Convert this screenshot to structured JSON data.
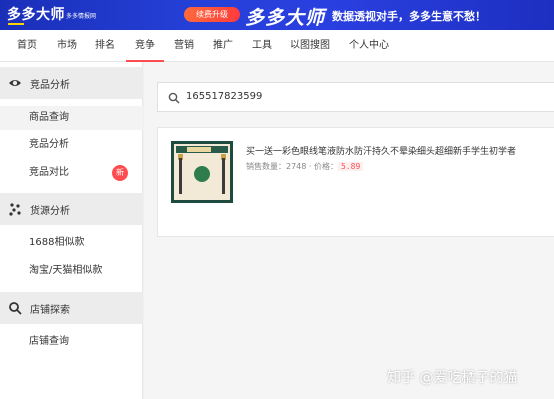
{
  "banner": {
    "logo": "多多大师",
    "logo_sub": "多多情报网",
    "upgrade_button": "续费升级",
    "big_logo": "多多大师",
    "slogan": "数据透视对手，多多生意不愁！"
  },
  "nav": {
    "items": [
      {
        "label": "首页"
      },
      {
        "label": "市场"
      },
      {
        "label": "排名"
      },
      {
        "label": "竞争",
        "active": true
      },
      {
        "label": "营销"
      },
      {
        "label": "推广"
      },
      {
        "label": "工具"
      },
      {
        "label": "以图搜图"
      },
      {
        "label": "个人中心"
      }
    ]
  },
  "sidebar": {
    "sections": [
      {
        "title": "竞品分析",
        "icon": "eye-icon",
        "items": [
          {
            "label": "商品查询",
            "active": true
          },
          {
            "label": "竞品分析"
          },
          {
            "label": "竞品对比",
            "badge": "新"
          }
        ]
      },
      {
        "title": "货源分析",
        "icon": "cluster-icon",
        "items": [
          {
            "label": "1688相似款"
          },
          {
            "label": "淘宝/天猫相似款"
          }
        ]
      },
      {
        "title": "店铺探索",
        "icon": "search-icon",
        "items": [
          {
            "label": "店铺查询"
          }
        ]
      }
    ]
  },
  "search": {
    "value": "165517823599"
  },
  "product": {
    "title": "买一送一彩色眼线笔液防水防汗持久不晕染细头超细新手学生初学者",
    "sales_label": "销售数量：",
    "sales_value": "2748",
    "separator": "·",
    "price_label": "价格：",
    "price_value": "5.89"
  },
  "watermark": "知乎 @爱吃橘子的猫",
  "colors": {
    "banner_blue": "#2540d8",
    "accent_red": "#ff4d4f",
    "upgrade_orange": "#ff6a3d"
  }
}
